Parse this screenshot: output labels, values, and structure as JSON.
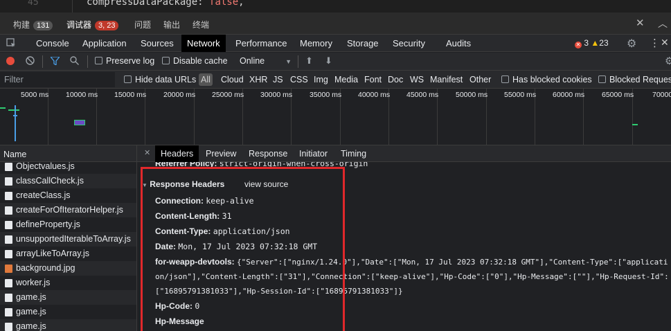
{
  "code_line": {
    "line_number": "45",
    "text_prefix": "compressDataPackage: ",
    "text_keyword": "false",
    "text_suffix": ","
  },
  "panel_tabs": [
    {
      "label": "构建",
      "badge": "131"
    },
    {
      "label": "调试器",
      "badge": "3, 23"
    },
    {
      "label": "问题"
    },
    {
      "label": "输出"
    },
    {
      "label": "终端"
    }
  ],
  "devtools_tabs": [
    "Console",
    "Application",
    "Sources",
    "Network",
    "Performance",
    "Memory",
    "Storage",
    "Security",
    "Audits"
  ],
  "active_tab": "Network",
  "status": {
    "errors": "3",
    "warnings": "23"
  },
  "toolbar": {
    "preserve_log": "Preserve log",
    "disable_cache": "Disable cache",
    "throttle": "Online"
  },
  "filter": {
    "placeholder": "Filter",
    "hide_data_urls": "Hide data URLs",
    "types": [
      "All",
      "Cloud",
      "XHR",
      "JS",
      "CSS",
      "Img",
      "Media",
      "Font",
      "Doc",
      "WS",
      "Manifest",
      "Other"
    ],
    "has_blocked_cookies": "Has blocked cookies",
    "blocked_requests": "Blocked Requests"
  },
  "timeline_ticks": [
    "5000 ms",
    "10000 ms",
    "15000 ms",
    "20000 ms",
    "25000 ms",
    "30000 ms",
    "35000 ms",
    "40000 ms",
    "45000 ms",
    "50000 ms",
    "55000 ms",
    "60000 ms",
    "65000 ms",
    "70000"
  ],
  "name_header": "Name",
  "files": [
    {
      "name": "Objectvalues.js",
      "type": "js"
    },
    {
      "name": "classCallCheck.js",
      "type": "js"
    },
    {
      "name": "createClass.js",
      "type": "js"
    },
    {
      "name": "createForOfIteratorHelper.js",
      "type": "js"
    },
    {
      "name": "defineProperty.js",
      "type": "js"
    },
    {
      "name": "unsupportedIterableToArray.js",
      "type": "js"
    },
    {
      "name": "arrayLikeToArray.js",
      "type": "js"
    },
    {
      "name": "background.jpg",
      "type": "img"
    },
    {
      "name": "worker.js",
      "type": "js"
    },
    {
      "name": "game.js",
      "type": "js"
    },
    {
      "name": "game.js",
      "type": "js"
    },
    {
      "name": "game.js",
      "type": "js"
    }
  ],
  "detail_tabs": [
    "Headers",
    "Preview",
    "Response",
    "Initiator",
    "Timing"
  ],
  "detail_active": "Headers",
  "referrer_policy": {
    "key": "Referrer Policy:",
    "value": "strict-origin-when-cross-origin"
  },
  "response_headers": {
    "title": "Response Headers",
    "view_source": "view source",
    "items": [
      {
        "key": "Connection:",
        "value": "keep-alive"
      },
      {
        "key": "Content-Length:",
        "value": "31"
      },
      {
        "key": "Content-Type:",
        "value": "application/json"
      },
      {
        "key": "Date:",
        "value": "Mon, 17 Jul 2023 07:32:18 GMT"
      },
      {
        "key": "for-weapp-devtools:",
        "value": "{\"Server\":[\"nginx/1.24.0\"],\"Date\":[\"Mon, 17 Jul 2023 07:32:18 GMT\"],\"Content-Type\":[\"applicati",
        "line2": "on/json\"],\"Content-Length\":[\"31\"],\"Connection\":[\"keep-alive\"],\"Hp-Code\":[\"0\"],\"Hp-Message\":[\"\"],\"Hp-Request-Id\":",
        "line3": "[\"16895791381033\"],\"Hp-Session-Id\":[\"16895791381033\"]}"
      },
      {
        "key": "Hp-Code:",
        "value": "0"
      },
      {
        "key": "Hp-Message",
        "value": ""
      }
    ]
  },
  "colors": {
    "highlight_border": "#e0282b",
    "active_tab_bg": "#000000",
    "error_red": "#e74c3c",
    "warning_yellow": "#f4c20d"
  }
}
